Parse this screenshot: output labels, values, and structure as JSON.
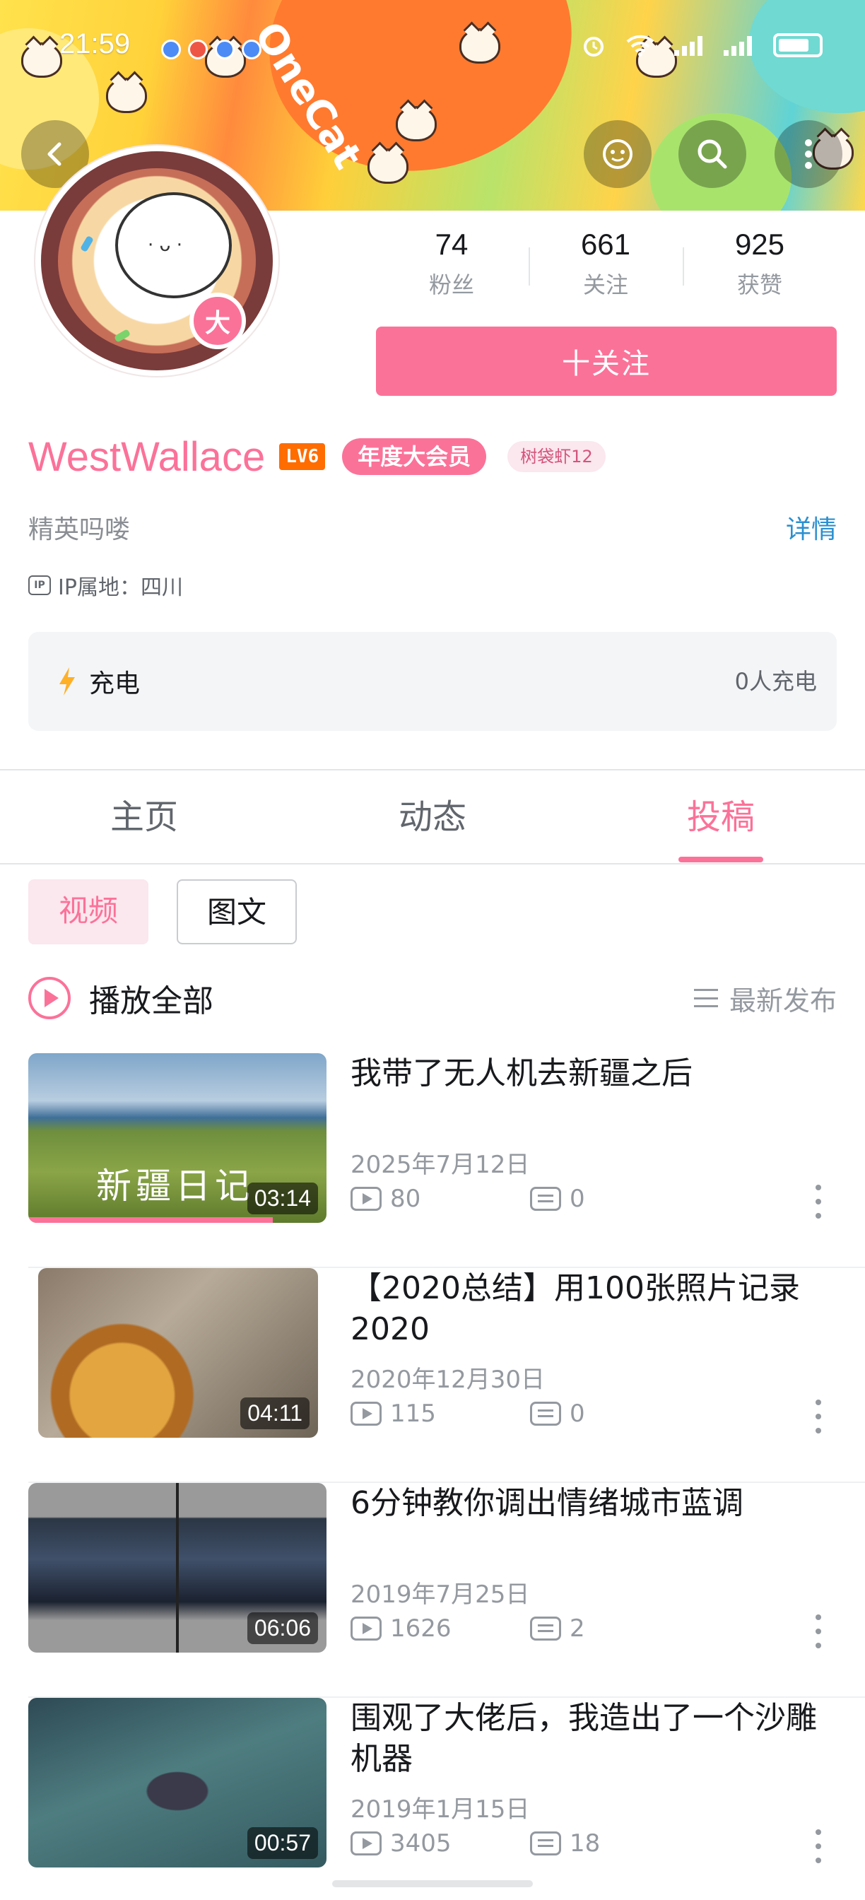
{
  "status_bar": {
    "time": "21:59"
  },
  "banner": {
    "art_text": "OneCat"
  },
  "avatar": {
    "badge": "大"
  },
  "stats": [
    {
      "value": "74",
      "label": "粉丝"
    },
    {
      "value": "661",
      "label": "关注"
    },
    {
      "value": "925",
      "label": "获赞"
    }
  ],
  "follow_label": "十关注",
  "profile": {
    "name": "WestWallace",
    "level": "LV6",
    "vip": "年度大会员",
    "tag": "树袋虾12",
    "signature": "精英吗喽",
    "detail_link": "详情",
    "ip_icon": "IP",
    "ip": "IP属地：四川"
  },
  "charge": {
    "label": "充电",
    "count": "0人充电"
  },
  "tabs": [
    "主页",
    "动态",
    "投稿"
  ],
  "segments": [
    "视频",
    "图文"
  ],
  "play_all": "播放全部",
  "sort_label": "最新发布",
  "videos": [
    {
      "title": "我带了无人机去新疆之后",
      "date": "2025年7月12日",
      "views": "80",
      "danmaku": "0",
      "duration": "03:14",
      "overlay": "新疆日记",
      "watched_fraction": 0.82
    },
    {
      "title": "【2020总结】用100张照片记录2020",
      "date": "2020年12月30日",
      "views": "115",
      "danmaku": "0",
      "duration": "04:11"
    },
    {
      "title": "6分钟教你调出情绪城市蓝调",
      "date": "2019年7月25日",
      "views": "1626",
      "danmaku": "2",
      "duration": "06:06"
    },
    {
      "title": "围观了大佬后，我造出了一个沙雕机器",
      "date": "2019年1月15日",
      "views": "3405",
      "danmaku": "18",
      "duration": "00:57"
    }
  ],
  "colors": {
    "accent": "#fb7299",
    "link": "#2a8fd0",
    "level": "#ff6c00"
  }
}
